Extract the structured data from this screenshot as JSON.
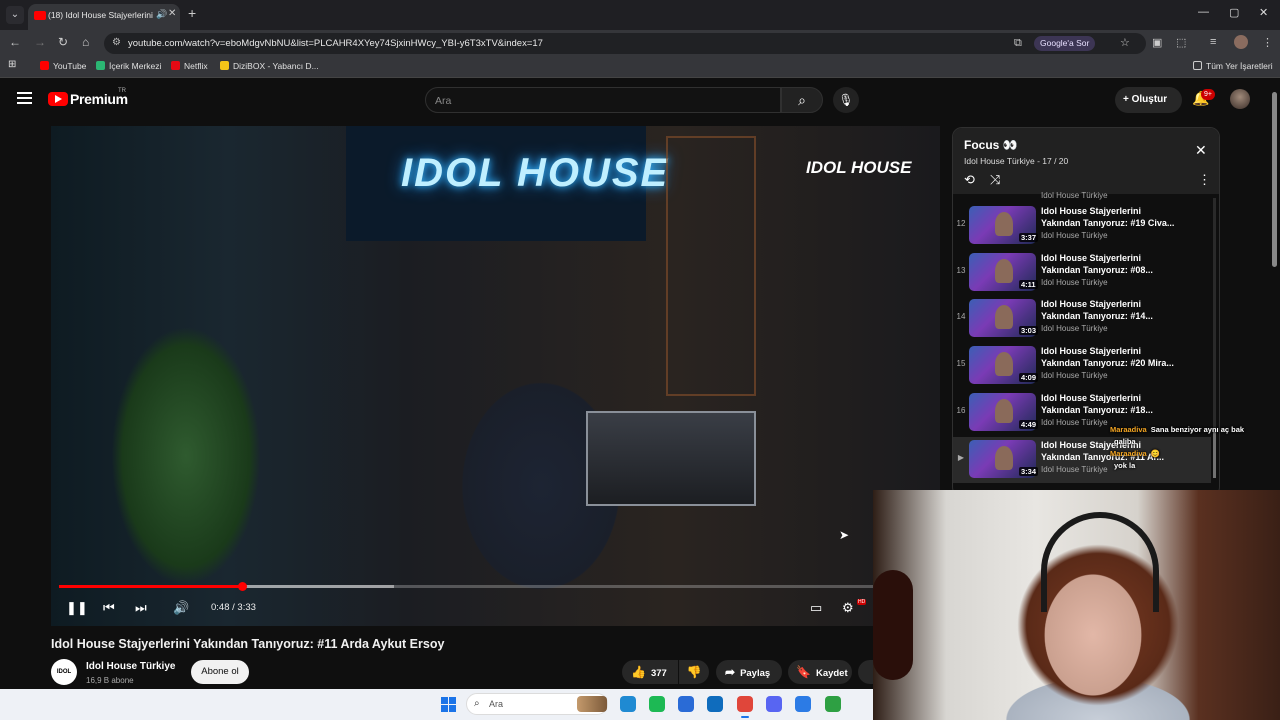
{
  "browser": {
    "tab_title": "(18) Idol House Stajyerlerini",
    "url": "youtube.com/watch?v=eboMdgvNbNU&list=PLCAHR4XYey74SjxinHWcy_YBI-y6T3xTV&index=17",
    "google_sor": "Google'a Sor",
    "bookmarks": [
      "YouTube",
      "İçerik Merkezi",
      "Netflix",
      "DiziBOX - Yabancı D..."
    ],
    "bookmark_colors": [
      "#ff0000",
      "#2bb673",
      "#e50914",
      "#f5c518"
    ],
    "all_bookmarks": "Tüm Yer İşaretleri"
  },
  "youtube": {
    "logo": "Premium",
    "logo_region": "TR",
    "search_placeholder": "Ara",
    "create_label": "Oluştur",
    "notifications": "9+"
  },
  "player": {
    "time": "0:48 / 3:33",
    "progress_fraction": 0.225,
    "watermark": "IDOL HOUSE",
    "neon_sign": "IDOL HOUSE"
  },
  "video": {
    "title": "Idol House Stajyerlerini Yakından Tanıyoruz: #11 Arda Aykut Ersoy",
    "channel": "Idol House Türkiye",
    "subscribers": "16,9 B abone",
    "subscribe_label": "Abone ol",
    "likes": "377",
    "share_label": "Paylaş",
    "save_label": "Kaydet",
    "channel_avatar_text": "IDOL"
  },
  "playlist": {
    "title": "Focus 👀",
    "subtitle": "Idol House Türkiye - 17 / 20",
    "top_channel": "Idol House Türkiye",
    "items": [
      {
        "num": "12",
        "line1": "Idol House Stajyerlerini",
        "line2": "Yakından Tanıyoruz: #19 Civa...",
        "channel": "Idol House Türkiye",
        "duration": "3:37"
      },
      {
        "num": "13",
        "line1": "Idol House Stajyerlerini",
        "line2": "Yakından Tanıyoruz: #08...",
        "channel": "Idol House Türkiye",
        "duration": "4:11"
      },
      {
        "num": "14",
        "line1": "Idol House Stajyerlerini",
        "line2": "Yakından Tanıyoruz: #14...",
        "channel": "Idol House Türkiye",
        "duration": "3:03"
      },
      {
        "num": "15",
        "line1": "Idol House Stajyerlerini",
        "line2": "Yakından Tanıyoruz: #20 Mira...",
        "channel": "Idol House Türkiye",
        "duration": "4:09"
      },
      {
        "num": "16",
        "line1": "Idol House Stajyerlerini",
        "line2": "Yakından Tanıyoruz: #18...",
        "channel": "Idol House Türkiye",
        "duration": "4:49"
      },
      {
        "num": "▶",
        "line1": "Idol House Stajyerlerini",
        "line2": "Yakından Tanıyoruz: #11 Ar...",
        "channel": "Idol House Türkiye",
        "duration": "3:34"
      }
    ]
  },
  "chat": [
    {
      "user": "Maraadiva",
      "message": "Sana benziyor aynı aç bak"
    },
    {
      "user": "",
      "message": "galiba"
    },
    {
      "user": "Maraadiva",
      "message": "😊"
    },
    {
      "user": "",
      "message": "yok la"
    }
  ],
  "taskbar": {
    "search_placeholder": "Ara",
    "apps": [
      {
        "name": "edge",
        "color": "#1f8ad2"
      },
      {
        "name": "spotify",
        "color": "#1db954"
      },
      {
        "name": "store",
        "color": "#2a6bd6"
      },
      {
        "name": "outlook",
        "color": "#0f6cbd"
      },
      {
        "name": "chrome",
        "color": "#e0463a"
      },
      {
        "name": "discord",
        "color": "#5865f2"
      },
      {
        "name": "monitor",
        "color": "#2c7be5"
      },
      {
        "name": "app",
        "color": "#2ea043"
      }
    ]
  }
}
